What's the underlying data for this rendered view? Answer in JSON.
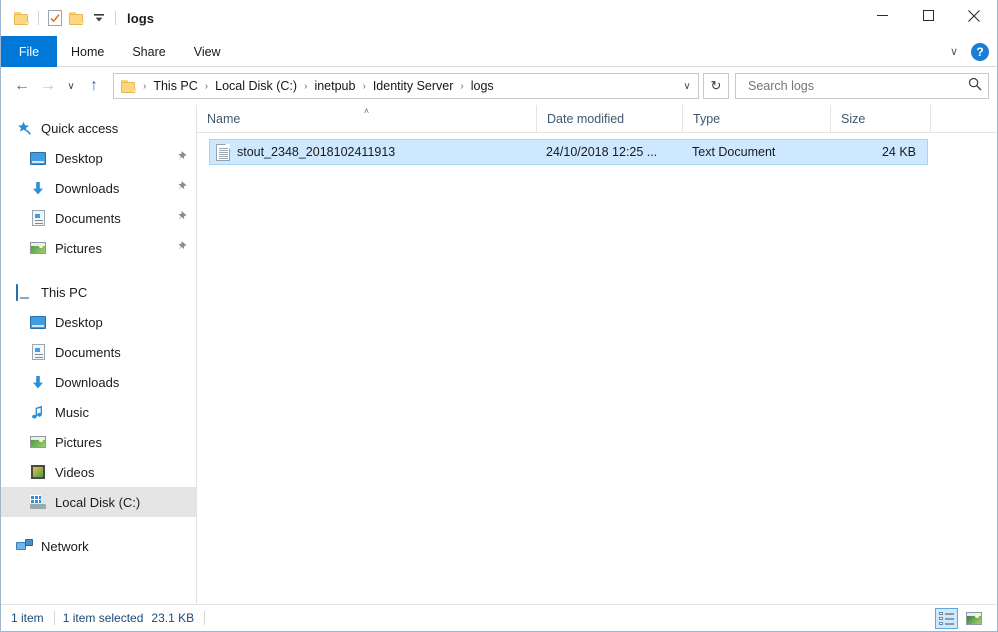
{
  "window": {
    "title": "logs",
    "quick_access_toolbar": [
      {
        "name": "folder-icon",
        "label": "Folder"
      },
      {
        "name": "properties-icon",
        "label": "Properties"
      },
      {
        "name": "new-folder-icon",
        "label": "New folder"
      },
      {
        "name": "customize-dropdown-icon",
        "label": "Customize Quick Access Toolbar"
      }
    ],
    "controls": {
      "minimize": "─",
      "maximize": "☐",
      "close": "✕"
    }
  },
  "ribbon": {
    "tabs": [
      {
        "label": "File",
        "active": true
      },
      {
        "label": "Home",
        "active": false
      },
      {
        "label": "Share",
        "active": false
      },
      {
        "label": "View",
        "active": false
      }
    ],
    "collapse_chevron": "∨",
    "help_label": "?"
  },
  "address_bar": {
    "back": "←",
    "forward": "→",
    "recent_locations": "∨",
    "up": "↑",
    "breadcrumbs": [
      {
        "label": "This PC"
      },
      {
        "label": "Local Disk (C:)"
      },
      {
        "label": "inetpub"
      },
      {
        "label": "Identity Server"
      },
      {
        "label": "logs"
      }
    ],
    "separator": "›",
    "dropdown": "∨",
    "refresh": "↻"
  },
  "search": {
    "placeholder": "Search logs",
    "value": "",
    "icon": "search-icon"
  },
  "nav_pane": {
    "groups": [
      {
        "header": {
          "label": "Quick access",
          "icon": "star-pin-icon"
        },
        "items": [
          {
            "label": "Desktop",
            "icon": "monitor-icon",
            "pinned": true
          },
          {
            "label": "Downloads",
            "icon": "download-arrow-icon",
            "pinned": true
          },
          {
            "label": "Documents",
            "icon": "document-icon",
            "pinned": true
          },
          {
            "label": "Pictures",
            "icon": "picture-icon",
            "pinned": true
          }
        ]
      },
      {
        "header": {
          "label": "This PC",
          "icon": "computer-icon"
        },
        "items": [
          {
            "label": "Desktop",
            "icon": "monitor-icon",
            "pinned": false
          },
          {
            "label": "Documents",
            "icon": "document-icon",
            "pinned": false
          },
          {
            "label": "Downloads",
            "icon": "download-arrow-icon",
            "pinned": false
          },
          {
            "label": "Music",
            "icon": "music-note-icon",
            "pinned": false
          },
          {
            "label": "Pictures",
            "icon": "picture-icon",
            "pinned": false
          },
          {
            "label": "Videos",
            "icon": "video-icon",
            "pinned": false
          },
          {
            "label": "Local Disk (C:)",
            "icon": "disk-drive-icon",
            "pinned": false,
            "selected": true
          }
        ]
      },
      {
        "header": {
          "label": "Network",
          "icon": "network-icon"
        },
        "items": []
      }
    ],
    "pin_glyph": "📌"
  },
  "file_list": {
    "columns": [
      {
        "label": "Name",
        "sorted": true,
        "sort_direction": "ascending",
        "sort_glyph": "˄"
      },
      {
        "label": "Date modified",
        "sorted": false
      },
      {
        "label": "Type",
        "sorted": false
      },
      {
        "label": "Size",
        "sorted": false
      }
    ],
    "rows": [
      {
        "name": "stout_2348_2018102411913",
        "date_modified": "24/10/2018 12:25 ...",
        "type": "Text Document",
        "size": "24 KB",
        "icon": "text-document-icon",
        "selected": true
      }
    ]
  },
  "status_bar": {
    "item_count": "1 item",
    "selection_info": "1 item selected",
    "selection_size": "23.1 KB",
    "views": [
      {
        "name": "details-view",
        "active": true
      },
      {
        "name": "large-icons-view",
        "active": false
      }
    ]
  },
  "colors": {
    "accent": "#0078d7",
    "selection": "#cde8ff",
    "selection_border": "#a9d4f5",
    "nav_selected": "#e5e5e5",
    "header_text": "#3f5870",
    "status_text": "#1b4a7a",
    "folder_yellow": "#fcd77f"
  }
}
